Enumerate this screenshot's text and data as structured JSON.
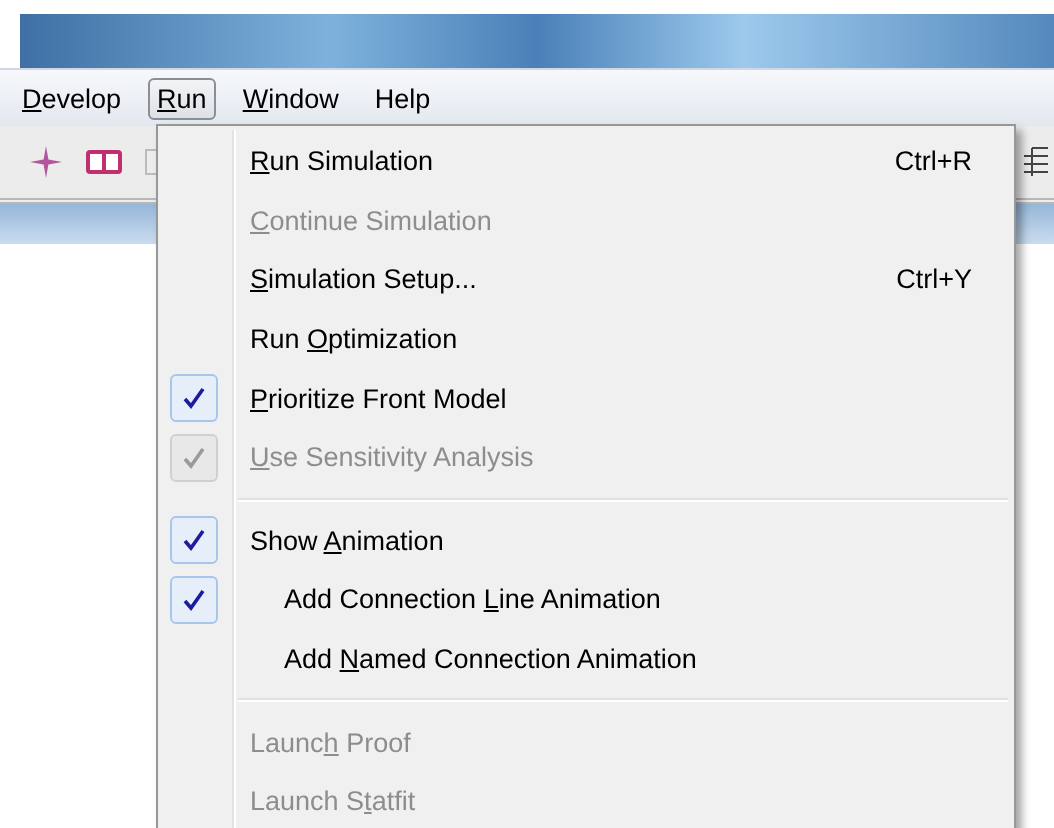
{
  "menu_bar": [
    {
      "mnemonic": "D",
      "after": "evelop",
      "selected": false
    },
    {
      "mnemonic": "R",
      "after": "un",
      "selected": true
    },
    {
      "mnemonic": "W",
      "after": "indow",
      "selected": false
    },
    {
      "before": "Help",
      "selected": false
    }
  ],
  "run_menu": {
    "items": [
      {
        "kind": "item",
        "mnemonic": "R",
        "after": "un Simulation",
        "shortcut": "Ctrl+R",
        "disabled": false,
        "checked": false
      },
      {
        "kind": "item",
        "mnemonic": "C",
        "after": "ontinue Simulation",
        "disabled": true,
        "checked": false
      },
      {
        "kind": "item",
        "mnemonic": "S",
        "after": "imulation Setup...",
        "shortcut": "Ctrl+Y",
        "disabled": false,
        "checked": false
      },
      {
        "kind": "item",
        "before": "Run ",
        "mnemonic": "O",
        "after": "ptimization",
        "disabled": false,
        "checked": false
      },
      {
        "kind": "item",
        "mnemonic": "P",
        "after": "rioritize Front Model",
        "disabled": false,
        "checked": true
      },
      {
        "kind": "item",
        "mnemonic": "U",
        "after": "se Sensitivity Analysis",
        "disabled": true,
        "checked": true
      },
      {
        "kind": "separator"
      },
      {
        "kind": "item",
        "before": "Show ",
        "mnemonic": "A",
        "after": "nimation",
        "disabled": false,
        "checked": true,
        "children": [
          {
            "before": "Add Connection ",
            "mnemonic": "L",
            "after": "ine Animation",
            "disabled": false,
            "checked": true
          },
          {
            "before": "Add ",
            "mnemonic": "N",
            "after": "amed Connection Animation",
            "disabled": false,
            "checked": false
          }
        ]
      },
      {
        "kind": "separator"
      },
      {
        "kind": "item",
        "before": "Launc",
        "mnemonic": "h",
        "after": " Proof",
        "disabled": true,
        "checked": false
      },
      {
        "kind": "item",
        "before": "Launch S",
        "mnemonic": "t",
        "after": "atfit",
        "disabled": true,
        "checked": false
      }
    ]
  }
}
